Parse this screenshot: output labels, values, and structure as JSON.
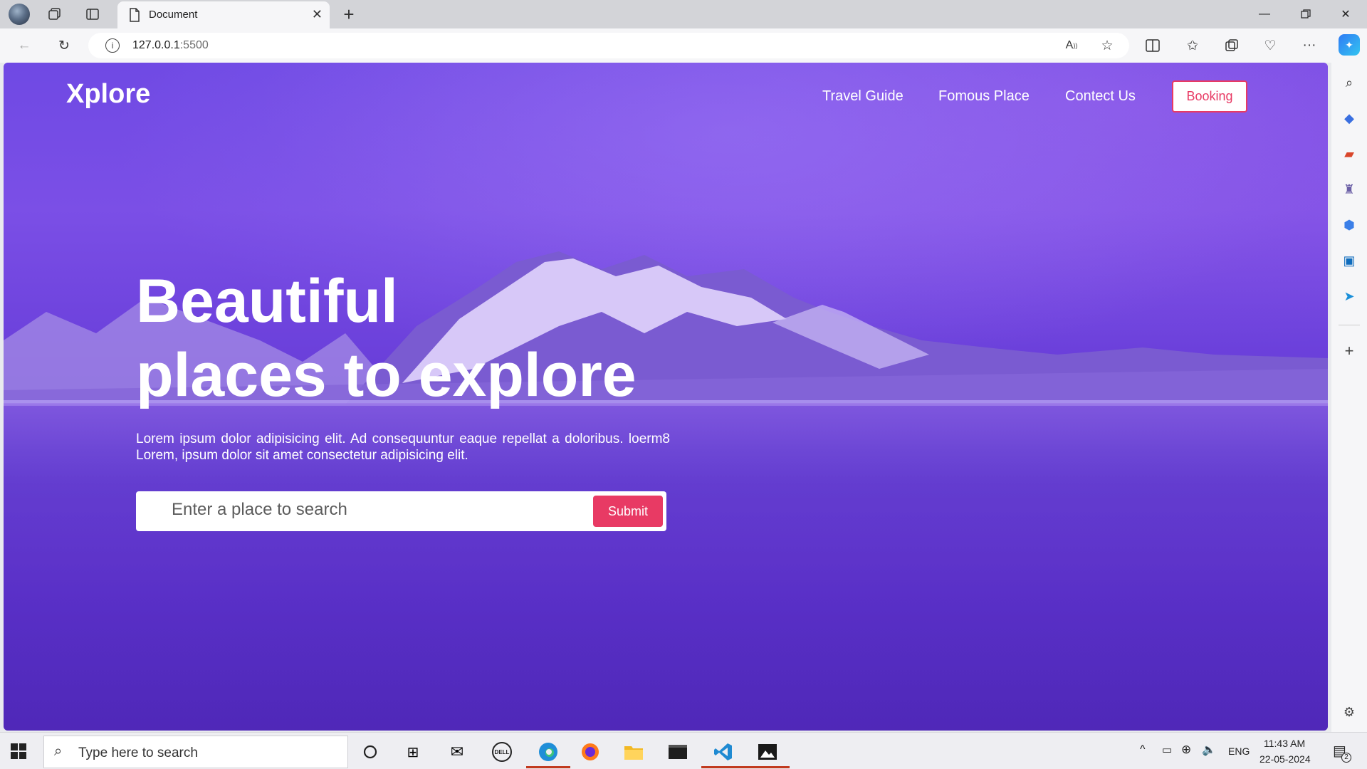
{
  "browser": {
    "tab_title": "Document",
    "url_host": "127.0.0.1",
    "url_port": ":5500"
  },
  "site": {
    "logo": "Xplore",
    "nav": [
      "Travel Guide",
      "Fomous Place",
      "Contect Us"
    ],
    "booking_label": "Booking",
    "hero_title_line1": "Beautiful",
    "hero_title_line2": "places to explore",
    "hero_text": "Lorem ipsum dolor adipisicing elit. Ad consequuntur eaque repellat a doloribus. loerm8 Lorem, ipsum dolor sit amet consectetur adipisicing elit.",
    "search_placeholder": "Enter a place to search",
    "submit_label": "Submit",
    "colors": {
      "accent": "#e83a64",
      "overlay": "#6f49e4"
    }
  },
  "taskbar": {
    "search_placeholder": "Type here to search",
    "language": "ENG",
    "time": "11:43 AM",
    "date": "22-05-2024",
    "notification_count": "2"
  }
}
